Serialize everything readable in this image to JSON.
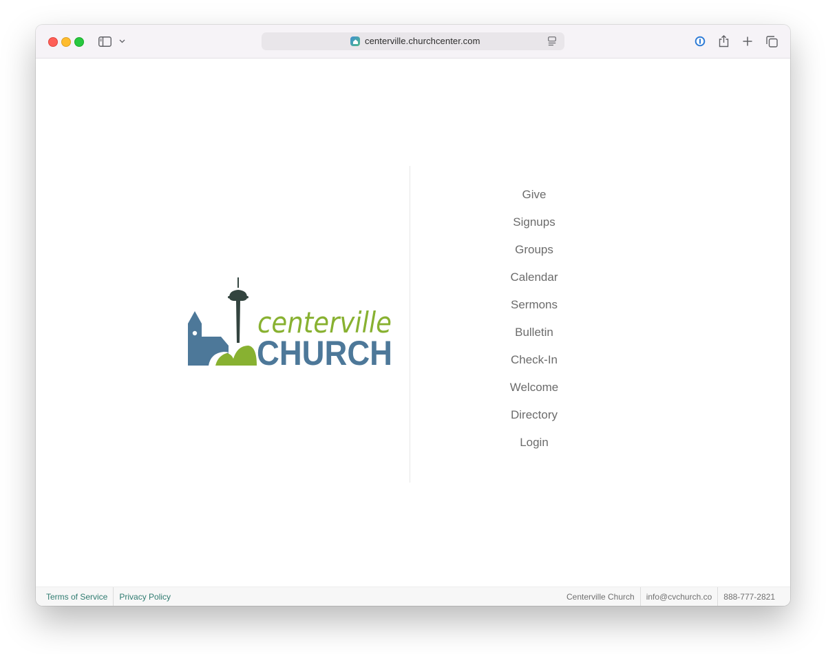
{
  "browser": {
    "url": "centerville.churchcenter.com"
  },
  "logo": {
    "line1": "centerville",
    "line2": "CHURCH",
    "colors": {
      "green": "#88b131",
      "blue": "#4d7899",
      "dark": "#33443f"
    }
  },
  "nav": {
    "items": [
      {
        "label": "Give"
      },
      {
        "label": "Signups"
      },
      {
        "label": "Groups"
      },
      {
        "label": "Calendar"
      },
      {
        "label": "Sermons"
      },
      {
        "label": "Bulletin"
      },
      {
        "label": "Check-In"
      },
      {
        "label": "Welcome"
      },
      {
        "label": "Directory"
      },
      {
        "label": "Login"
      }
    ]
  },
  "footer": {
    "links": [
      {
        "label": "Terms of Service"
      },
      {
        "label": "Privacy Policy"
      }
    ],
    "org_name": "Centerville Church",
    "email": "info@cvchurch.co",
    "phone": "888-777-2821"
  },
  "icons": {
    "sidebar": "sidebar-icon",
    "chevron": "chevron-down-icon",
    "site": "home-icon",
    "reader": "reader-icon",
    "password": "password-manager-icon",
    "share": "share-icon",
    "new_tab": "plus-icon",
    "tabs": "tabs-overview-icon"
  },
  "colors": {
    "link": "#2f7b70",
    "nav_text": "#6b6b6b"
  }
}
